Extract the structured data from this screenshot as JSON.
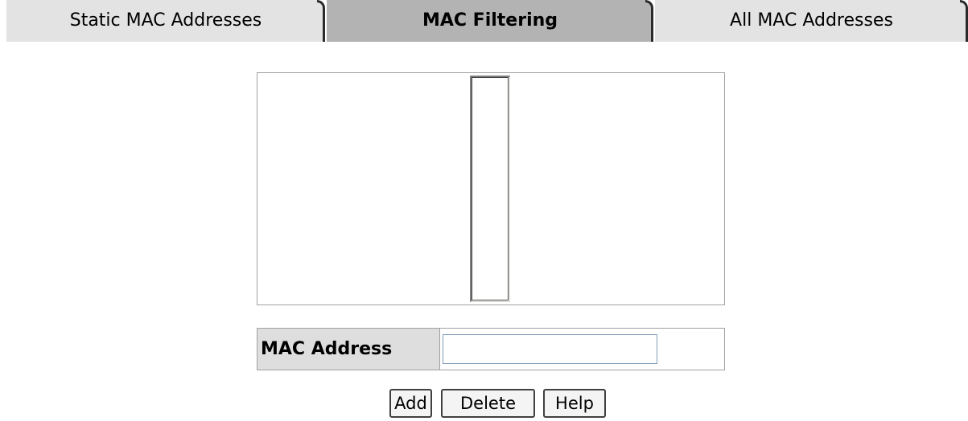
{
  "tabs": [
    {
      "label": "Static MAC Addresses",
      "active": false
    },
    {
      "label": "MAC Filtering",
      "active": true
    },
    {
      "label": "All MAC Addresses",
      "active": false
    }
  ],
  "mac_list": {
    "items": []
  },
  "mac_form": {
    "label": "MAC Address",
    "value": ""
  },
  "buttons": {
    "add": "Add",
    "delete": "Delete",
    "help": "Help"
  },
  "colors": {
    "tab_inactive": "#e3e3e3",
    "tab_active": "#b3b3b3",
    "label_bg": "#dedede"
  }
}
